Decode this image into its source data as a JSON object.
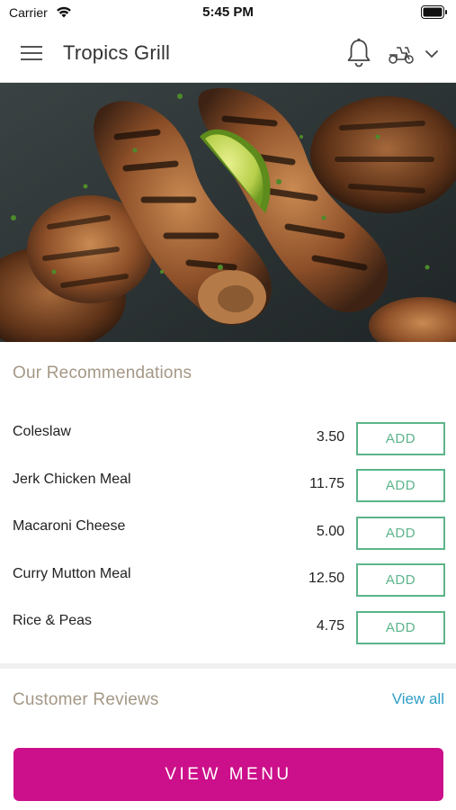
{
  "status_bar": {
    "carrier": "Carrier",
    "time": "5:45 PM"
  },
  "header": {
    "title": "Tropics Grill",
    "icons": [
      "menu-icon",
      "bell-icon",
      "delivery-scooter-icon",
      "chevron-down-icon"
    ]
  },
  "hero": {
    "image": "grilled-jerk-chicken-drumsticks-with-lime"
  },
  "recommendations": {
    "title": "Our Recommendations",
    "items": [
      {
        "name": "Coleslaw",
        "price": "3.50",
        "action": "ADD"
      },
      {
        "name": "Jerk Chicken Meal",
        "price": "11.75",
        "action": "ADD"
      },
      {
        "name": "Macaroni Cheese",
        "price": "5.00",
        "action": "ADD"
      },
      {
        "name": "Curry Mutton Meal",
        "price": "12.50",
        "action": "ADD"
      },
      {
        "name": "Rice & Peas",
        "price": "4.75",
        "action": "ADD"
      }
    ]
  },
  "reviews": {
    "title": "Customer Reviews",
    "view_all": "View all"
  },
  "footer": {
    "cta": "VIEW MENU"
  },
  "colors": {
    "accent": "#cc0f8a",
    "add_button": "#5cb48a",
    "section_title": "#a49886",
    "link": "#2f9fc7"
  }
}
